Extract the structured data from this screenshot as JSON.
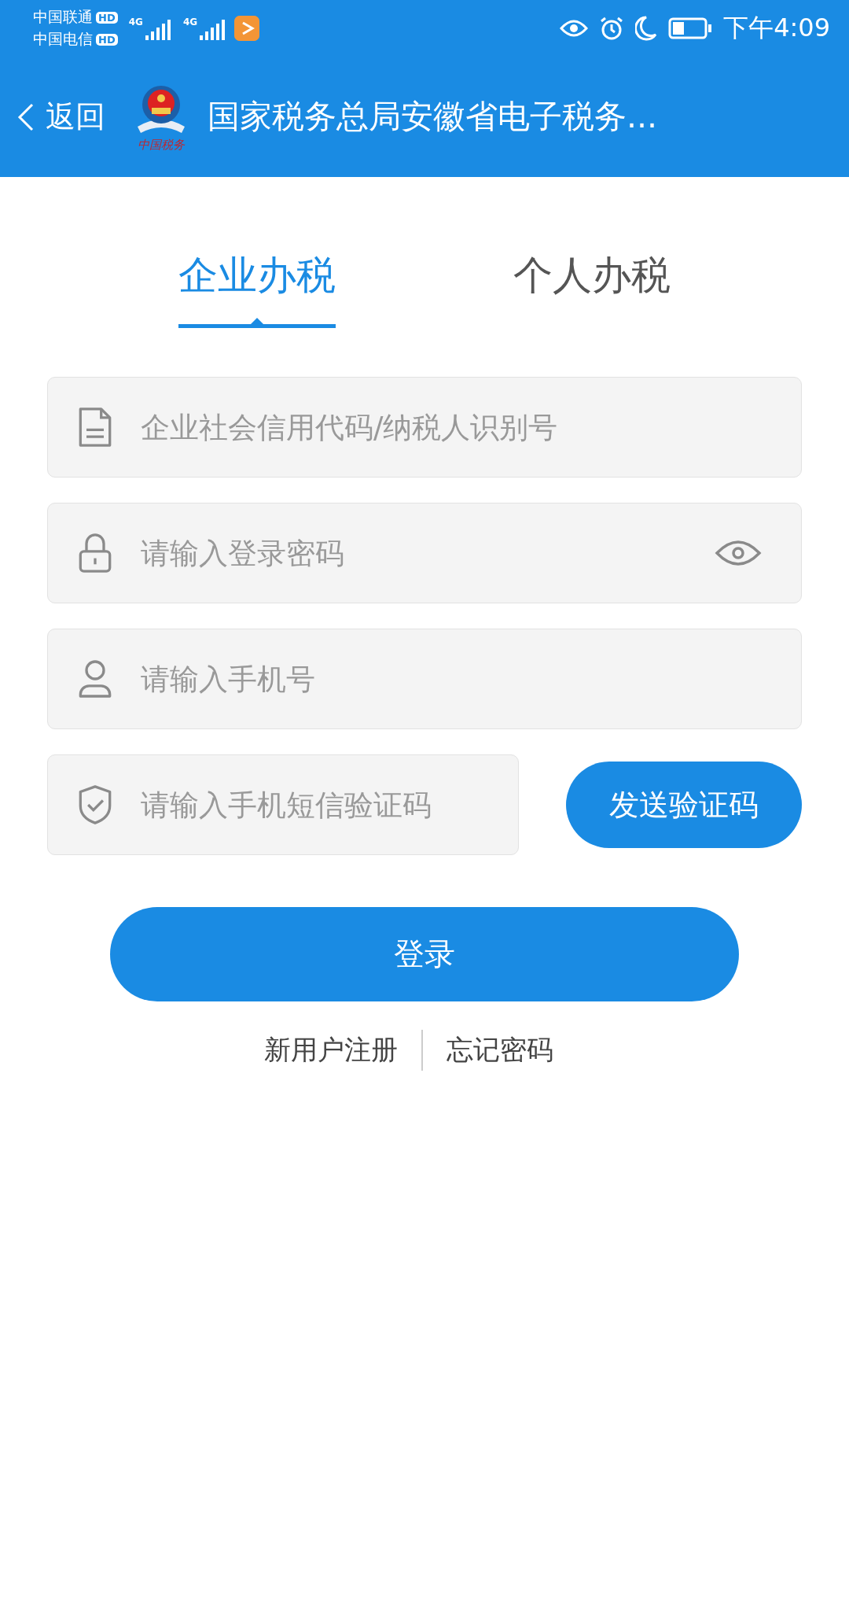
{
  "status_bar": {
    "carriers": [
      {
        "name": "中国联通",
        "badge": "HD",
        "network": "4G"
      },
      {
        "name": "中国电信",
        "badge": "HD",
        "network": "4G"
      }
    ],
    "time": "下午4:09"
  },
  "header": {
    "back": "返回",
    "logo_caption": "中国税务",
    "title": "国家税务总局安徽省电子税务..."
  },
  "tabs": [
    {
      "label": "企业办税",
      "selected": true
    },
    {
      "label": "个人办税",
      "selected": false
    }
  ],
  "fields": [
    {
      "kind": "document",
      "placeholder": "企业社会信用代码/纳税人识别号"
    },
    {
      "kind": "lock",
      "placeholder": "请输入登录密码",
      "reveal_toggle": true
    },
    {
      "kind": "person",
      "placeholder": "请输入手机号"
    },
    {
      "kind": "shield",
      "placeholder": "请输入手机短信验证码",
      "action": "发送验证码"
    }
  ],
  "login_button": "登录",
  "links": [
    "新用户注册",
    "忘记密码"
  ]
}
